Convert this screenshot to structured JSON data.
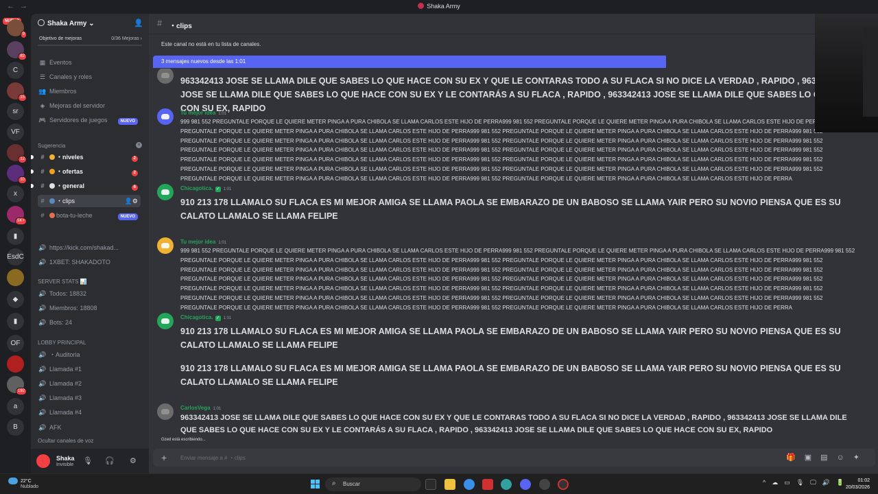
{
  "window": {
    "title": "Shaka Army",
    "nav_back": "←",
    "nav_forward": "→"
  },
  "rail": {
    "nuevo": "NUEVO",
    "servers": [
      {
        "label": "",
        "badge": "9",
        "color": "#7a4f3a"
      },
      {
        "label": "",
        "badge": "82",
        "color": "#5a4060"
      },
      {
        "label": "C",
        "badge": ""
      },
      {
        "label": "",
        "badge": "15",
        "color": "#7b3a3a"
      },
      {
        "label": "sr",
        "badge": ""
      },
      {
        "label": "VF",
        "badge": ""
      },
      {
        "label": "",
        "badge": "12",
        "color": "#6a2f2f"
      },
      {
        "label": "",
        "badge": "10",
        "color": "#5c2d7a"
      },
      {
        "label": "x",
        "badge": ""
      },
      {
        "label": "",
        "badge": "5K+",
        "color": "#9c2a6a"
      },
      {
        "label": "▮",
        "badge": ""
      },
      {
        "label": "EsdC",
        "badge": ""
      },
      {
        "label": "",
        "badge": "",
        "color": "#8a6a20"
      },
      {
        "label": "◆",
        "badge": ""
      },
      {
        "label": "▮",
        "badge": ""
      },
      {
        "label": "OF",
        "badge": ""
      },
      {
        "label": "",
        "badge": "",
        "color": "#b02020"
      },
      {
        "label": "",
        "badge": "192",
        "color": "#606060"
      },
      {
        "label": "a",
        "badge": ""
      },
      {
        "label": "B",
        "badge": ""
      }
    ]
  },
  "sidebar": {
    "server_name": "Shaka Army",
    "goal_label": "Objetivo de mejoras",
    "goal_value": "0/36 Mejoras",
    "top_items": [
      {
        "label": "Eventos",
        "icon": "calendar-icon",
        "glyph": "▦"
      },
      {
        "label": "Canales y roles",
        "icon": "list-icon",
        "glyph": "☰"
      },
      {
        "label": "Miembros",
        "icon": "members-icon",
        "glyph": "👥"
      },
      {
        "label": "Mejoras del servidor",
        "icon": "boost-icon",
        "glyph": "◈"
      },
      {
        "label": "Servidores de juegos",
        "icon": "gamepad-icon",
        "glyph": "🎮",
        "tag": "NUEVO"
      }
    ],
    "suggest_label": "Sugerencia",
    "channels": [
      {
        "label": "・niveles",
        "count": "2",
        "unread": true,
        "emoji": "#f0b232"
      },
      {
        "label": "・ofertas",
        "count": "2",
        "unread": true,
        "emoji": "#f0a020"
      },
      {
        "label": "・general",
        "count": "6",
        "unread": true,
        "emoji": "#e0e0e0"
      },
      {
        "label": "・clips",
        "count": "",
        "active": true,
        "emoji": "#5a8ac0"
      },
      {
        "label": "bota-tu-leche",
        "tag": "NUEVO",
        "emoji": "#e07050"
      }
    ],
    "links": [
      {
        "label": "https://kick.com/shakad...",
        "icon": "speaker-icon"
      },
      {
        "label": "1XBET: SHAKADOTO",
        "icon": "speaker-icon"
      }
    ],
    "stats_label": "SERVER STATS 📊",
    "stats": [
      {
        "label": "Todos: 18832"
      },
      {
        "label": "Miembros: 18808"
      },
      {
        "label": "Bots: 24"
      }
    ],
    "lobby_label": "LOBBY PRINCIPAL",
    "voice": [
      {
        "label": "・Auditoria"
      },
      {
        "label": "Llamada #1"
      },
      {
        "label": "Llamada #2"
      },
      {
        "label": "Llamada #3"
      },
      {
        "label": "Llamada #4"
      },
      {
        "label": "AFK"
      }
    ],
    "hide_voice": "Ocultar canales de voz",
    "user": {
      "name": "Shaka",
      "status": "Invisible"
    }
  },
  "channel": {
    "name": "・clips",
    "notice": "Este canal no está en tu lista de canales.",
    "new_messages": "3 mensajes nuevos desde las 1:01",
    "input_placeholder": "Enviar mensaje a #  ・clips",
    "typing": "Gzed está escribiendo..."
  },
  "messages": [
    {
      "author": "",
      "time": "",
      "color": "#f2f3f5",
      "big": true,
      "text": "963342413 JOSE SE LLAMA DILE QUE SABES LO QUE HACE CON SU EX Y QUE LE CONTARAS TODO A SU FLACA SI NO DICE LA VERDAD , RAPIDO , 963342413 JOSE SE LLAMA DILE QUE SABES LO QUE HACE CON SU EX Y LE CONTARÁS A SU FLACA , RAPIDO , 963342413 JOSE SE LLAMA DILE QUE SABES LO QUE HACE CON SU EX, RAPIDO"
    },
    {
      "author": "Tu mejor idea",
      "time": "1:01",
      "color": "#23a55a",
      "big": false,
      "avatar": "blue",
      "text": "999 981 552 PREGUNTALE PORQUE LE QUIERE METER PINGA A PURA CHIBOLA SE LLAMA CARLOS ESTE HIJO DE PERRA999 981 552 PREGUNTALE PORQUE LE QUIERE METER PINGA A PURA CHIBOLA SE LLAMA CARLOS ESTE HIJO DE PERRA999 981 552 PREGUNTALE PORQUE LE QUIERE METER PINGA A PURA CHIBOLA SE LLAMA CARLOS ESTE HIJO DE PERRA999 981 552 PREGUNTALE PORQUE LE QUIERE METER PINGA A PURA CHIBOLA SE LLAMA CARLOS ESTE HIJO DE PERRA999 981 552 PREGUNTALE PORQUE LE QUIERE METER PINGA A PURA CHIBOLA SE LLAMA CARLOS ESTE HIJO DE PERRA999 981 552 PREGUNTALE PORQUE LE QUIERE METER PINGA A PURA CHIBOLA SE LLAMA CARLOS ESTE HIJO DE PERRA999 981 552 PREGUNTALE PORQUE LE QUIERE METER PINGA A PURA CHIBOLA SE LLAMA CARLOS ESTE HIJO DE PERRA999 981 552 PREGUNTALE PORQUE LE QUIERE METER PINGA A PURA CHIBOLA SE LLAMA CARLOS ESTE HIJO DE PERRA999 981 552 PREGUNTALE PORQUE LE QUIERE METER PINGA A PURA CHIBOLA SE LLAMA CARLOS ESTE HIJO DE PERRA999 981 552 PREGUNTALE PORQUE LE QUIERE METER PINGA A PURA CHIBOLA SE LLAMA CARLOS ESTE HIJO DE PERRA999 981 552 PREGUNTALE PORQUE LE QUIERE METER PINGA A PURA CHIBOLA SE LLAMA CARLOS ESTE HIJO DE PERRA999 981 552 PREGUNTALE PORQUE LE QUIERE METER PINGA A PURA CHIBOLA SE LLAMA CARLOS ESTE HIJO DE PERRA999 981 552 PREGUNTALE PORQUE LE QUIERE METER PINGA A PURA CHIBOLA SE LLAMA CARLOS ESTE HIJO DE PERRA999 981 552 PREGUNTALE PORQUE LE QUIERE METER PINGA A PURA CHIBOLA SE LLAMA CARLOS ESTE HIJO DE PERRA"
    },
    {
      "author": "Chicagotica.",
      "time": "1:01",
      "color": "#23a55a",
      "big": true,
      "avatar": "green",
      "check": "✓",
      "text": "910 213 178 LLAMALO SU FLACA ES MI MEJOR AMIGA SE LLAMA PAOLA SE EMBARAZO DE UN BABOSO SE LLAMA YAIR PERO SU NOVIO PIENSA QUE ES SU CALATO LLAMALO  SE LLAMA FELIPE"
    },
    {
      "author": "Tu mejor idea",
      "time": "1:01",
      "color": "#23a55a",
      "big": false,
      "avatar": "orange",
      "text": "999 981 552 PREGUNTALE PORQUE LE QUIERE METER PINGA A PURA CHIBOLA SE LLAMA CARLOS ESTE HIJO DE PERRA999 981 552 PREGUNTALE PORQUE LE QUIERE METER PINGA A PURA CHIBOLA SE LLAMA CARLOS ESTE HIJO DE PERRA999 981 552 PREGUNTALE PORQUE LE QUIERE METER PINGA A PURA CHIBOLA SE LLAMA CARLOS ESTE HIJO DE PERRA999 981 552 PREGUNTALE PORQUE LE QUIERE METER PINGA A PURA CHIBOLA SE LLAMA CARLOS ESTE HIJO DE PERRA999 981 552 PREGUNTALE PORQUE LE QUIERE METER PINGA A PURA CHIBOLA SE LLAMA CARLOS ESTE HIJO DE PERRA999 981 552 PREGUNTALE PORQUE LE QUIERE METER PINGA A PURA CHIBOLA SE LLAMA CARLOS ESTE HIJO DE PERRA999 981 552 PREGUNTALE PORQUE LE QUIERE METER PINGA A PURA CHIBOLA SE LLAMA CARLOS ESTE HIJO DE PERRA999 981 552 PREGUNTALE PORQUE LE QUIERE METER PINGA A PURA CHIBOLA SE LLAMA CARLOS ESTE HIJO DE PERRA999 981 552 PREGUNTALE PORQUE LE QUIERE METER PINGA A PURA CHIBOLA SE LLAMA CARLOS ESTE HIJO DE PERRA999 981 552 PREGUNTALE PORQUE LE QUIERE METER PINGA A PURA CHIBOLA SE LLAMA CARLOS ESTE HIJO DE PERRA999 981 552 PREGUNTALE PORQUE LE QUIERE METER PINGA A PURA CHIBOLA SE LLAMA CARLOS ESTE HIJO DE PERRA999 981 552 PREGUNTALE PORQUE LE QUIERE METER PINGA A PURA CHIBOLA SE LLAMA CARLOS ESTE HIJO DE PERRA999 981 552 PREGUNTALE PORQUE LE QUIERE METER PINGA A PURA CHIBOLA SE LLAMA CARLOS ESTE HIJO DE PERRA999 981 552 PREGUNTALE PORQUE LE QUIERE METER PINGA A PURA CHIBOLA SE LLAMA CARLOS ESTE HIJO DE PERRA"
    },
    {
      "author": "Chicagotica.",
      "time": "1:01",
      "color": "#23a55a",
      "big": true,
      "avatar": "green",
      "check": "✓",
      "text": "910 213 178 LLAMALO SU FLACA ES MI MEJOR AMIGA SE LLAMA PAOLA SE EMBARAZO DE UN BABOSO SE LLAMA YAIR PERO SU NOVIO PIENSA QUE ES SU CALATO LLAMALO  SE LLAMA FELIPE",
      "text2": "910 213 178 LLAMALO SU FLACA ES MI MEJOR AMIGA SE LLAMA PAOLA SE EMBARAZO DE UN BABOSO SE LLAMA YAIR PERO SU NOVIO PIENSA QUE ES SU CALATO LLAMALO  SE LLAMA FELIPE"
    },
    {
      "author": "CarlosVega",
      "time": "1:01",
      "color": "#23a55a",
      "big": false,
      "avatar": "photo",
      "text": "963342413 JOSE SE LLAMA DILE QUE SABES LO QUE HACE CON SU EX Y QUE LE CONTARAS TODO A SU FLACA SI NO DICE LA VERDAD , RAPIDO , 963342413 JOSE SE LLAMA DILE QUE SABES LO QUE HACE CON SU EX Y LE CONTARÁS A SU FLACA , RAPIDO , 963342413 JOSE SE LLAMA DILE QUE SABES LO QUE HACE CON SU EX, RAPIDO"
    }
  ],
  "taskbar": {
    "temp": "22°C",
    "weather": "Nublado",
    "search": "Buscar",
    "time": "01:02",
    "date": "20/03/2026"
  }
}
